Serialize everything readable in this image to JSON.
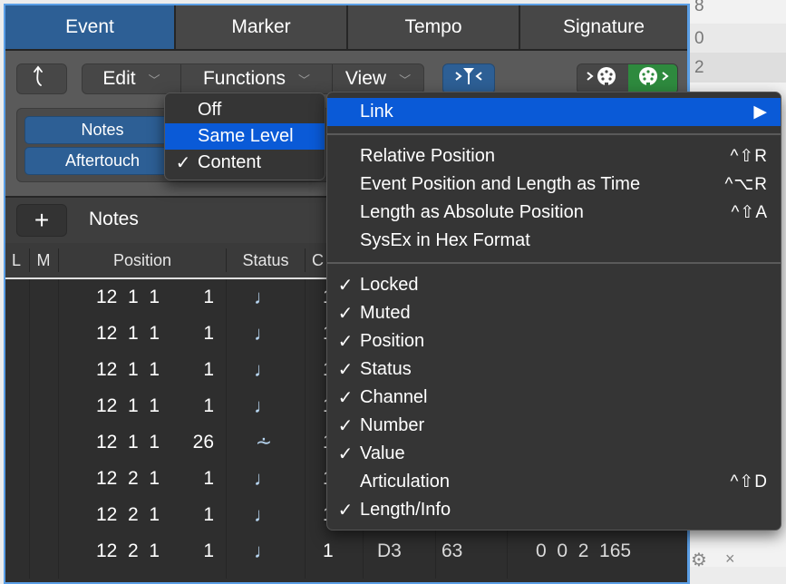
{
  "tabs": [
    {
      "label": "Event",
      "active": true
    },
    {
      "label": "Marker",
      "active": false
    },
    {
      "label": "Tempo",
      "active": false
    },
    {
      "label": "Signature",
      "active": false
    }
  ],
  "toolbar": {
    "back_icon": "hierarchy-up-arrow-icon",
    "menus": [
      {
        "label": "Edit"
      },
      {
        "label": "Functions"
      },
      {
        "label": "View"
      }
    ],
    "filter_icon": "midi-filter-icon",
    "midi_in_icon": "midi-in-icon",
    "midi_out_icon": "midi-out-icon"
  },
  "filters": {
    "buttons": [
      {
        "label": "Notes"
      },
      {
        "label": "Aftertouch"
      }
    ]
  },
  "link_menu": {
    "items": [
      {
        "label": "Off",
        "checked": false,
        "highlighted": false
      },
      {
        "label": "Same Level",
        "checked": false,
        "highlighted": true
      },
      {
        "label": "Content",
        "checked": true,
        "highlighted": false
      }
    ]
  },
  "list_header": {
    "add_label": "+",
    "title": "Notes"
  },
  "columns": [
    "L",
    "M",
    "Position",
    "Status",
    "C"
  ],
  "rows": [
    {
      "position": "12  1  1",
      "ticks": "1",
      "status": "note",
      "channel": "1",
      "number": "",
      "value": "",
      "length": ""
    },
    {
      "position": "12  1  1",
      "ticks": "1",
      "status": "note",
      "channel": "1",
      "number": "",
      "value": "",
      "length": ""
    },
    {
      "position": "12  1  1",
      "ticks": "1",
      "status": "note",
      "channel": "1",
      "number": "",
      "value": "",
      "length": ""
    },
    {
      "position": "12  1  1",
      "ticks": "1",
      "status": "note",
      "channel": "1",
      "number": "",
      "value": "",
      "length": ""
    },
    {
      "position": "12  1  1",
      "ticks": "26",
      "status": "controller",
      "channel": "1",
      "number": "",
      "value": "",
      "length": ""
    },
    {
      "position": "12  2  1",
      "ticks": "1",
      "status": "note",
      "channel": "1",
      "number": "",
      "value": "",
      "length": ""
    },
    {
      "position": "12  2  1",
      "ticks": "1",
      "status": "note",
      "channel": "1",
      "number": "",
      "value": "",
      "length": ""
    },
    {
      "position": "12  2  1",
      "ticks": "1",
      "status": "note",
      "channel": "1",
      "number": "D3",
      "value": "63",
      "length": "0  0  2  165"
    }
  ],
  "status_glyphs": {
    "note": "♩",
    "controller": "⩪"
  },
  "view_menu": {
    "groups": [
      [
        {
          "label": "Link",
          "checked": false,
          "highlighted": true,
          "submenu": true,
          "shortcut": "▶"
        }
      ],
      [
        {
          "label": "Relative Position",
          "checked": false,
          "shortcut": "^⇧R"
        },
        {
          "label": "Event Position and Length as Time",
          "checked": false,
          "shortcut": "^⌥R"
        },
        {
          "label": "Length as Absolute Position",
          "checked": false,
          "shortcut": "^⇧A"
        },
        {
          "label": "SysEx in Hex Format",
          "checked": false,
          "shortcut": ""
        }
      ],
      [
        {
          "label": "Locked",
          "checked": true,
          "shortcut": ""
        },
        {
          "label": "Muted",
          "checked": true,
          "shortcut": ""
        },
        {
          "label": "Position",
          "checked": true,
          "shortcut": ""
        },
        {
          "label": "Status",
          "checked": true,
          "shortcut": ""
        },
        {
          "label": "Channel",
          "checked": true,
          "shortcut": ""
        },
        {
          "label": "Number",
          "checked": true,
          "shortcut": ""
        },
        {
          "label": "Value",
          "checked": true,
          "shortcut": ""
        },
        {
          "label": "Articulation",
          "checked": false,
          "shortcut": "^⇧D"
        },
        {
          "label": "Length/Info",
          "checked": true,
          "shortcut": ""
        }
      ]
    ]
  },
  "background": {
    "rows": [
      "8",
      "0",
      "2"
    ]
  },
  "colors": {
    "accent_blue": "#0a5ad7",
    "tab_active": "#2d5f95",
    "midi_out_green": "#2e8a3e",
    "window_border": "#5b9fe6"
  }
}
